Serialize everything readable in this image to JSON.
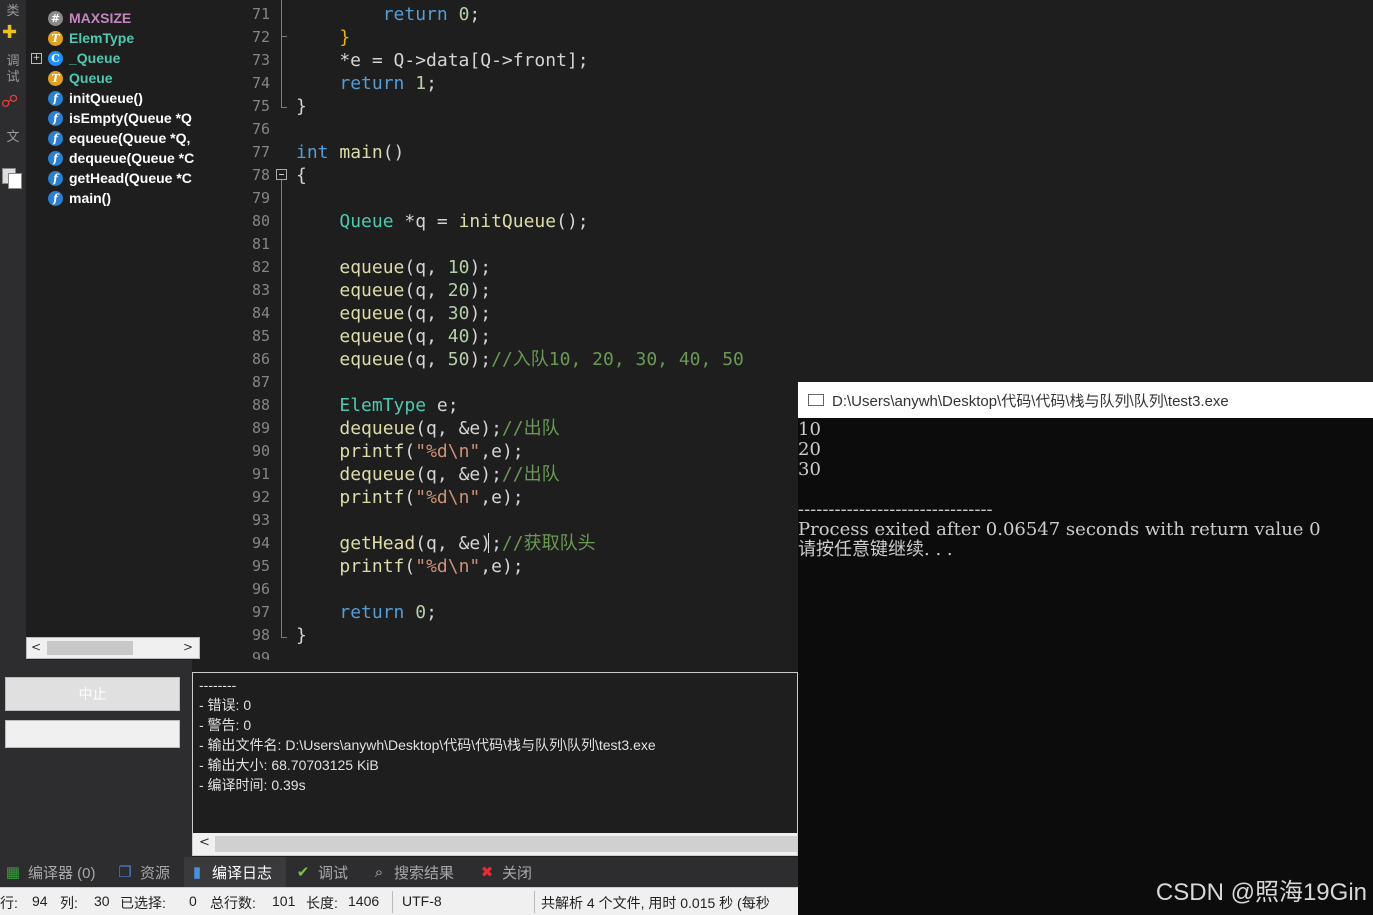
{
  "left_toolbar": {
    "labels": [
      "类",
      "调试",
      "文"
    ]
  },
  "class_browser": {
    "items": [
      {
        "name": "MAXSIZE",
        "kind": "#",
        "color": "#c586c0"
      },
      {
        "name": "ElemType",
        "kind": "T",
        "color": "#4ec9b0"
      },
      {
        "name": "_Queue",
        "kind": "C",
        "color": "#4ec9b0",
        "expandable": "+"
      },
      {
        "name": "Queue",
        "kind": "T",
        "color": "#4ec9b0"
      },
      {
        "name": "initQueue()",
        "kind": "f",
        "color": "#ffffff"
      },
      {
        "name": "isEmpty(Queue *Q",
        "kind": "f",
        "color": "#ffffff"
      },
      {
        "name": "equeue(Queue *Q,",
        "kind": "f",
        "color": "#ffffff"
      },
      {
        "name": "dequeue(Queue *C",
        "kind": "f",
        "color": "#ffffff"
      },
      {
        "name": "getHead(Queue *C",
        "kind": "f",
        "color": "#ffffff"
      },
      {
        "name": "main()",
        "kind": "f",
        "color": "#ffffff"
      }
    ],
    "scroll_left": "<",
    "scroll_right": ">"
  },
  "editor": {
    "line_numbers": [
      "71",
      "72",
      "73",
      "74",
      "75",
      "76",
      "77",
      "78",
      "79",
      "80",
      "81",
      "82",
      "83",
      "84",
      "85",
      "86",
      "87",
      "88",
      "89",
      "90",
      "91",
      "92",
      "93",
      "94",
      "95",
      "96",
      "97",
      "98",
      "99"
    ],
    "current_line": "94",
    "code_lines": [
      [
        {
          "t": "        "
        },
        {
          "t": "return",
          "c": "kw"
        },
        {
          "t": " "
        },
        {
          "t": "0",
          "c": "num"
        },
        {
          "t": ";"
        }
      ],
      [
        {
          "t": "    "
        },
        {
          "t": "}",
          "c": "br"
        }
      ],
      [
        {
          "t": "    *e = Q->data[Q->front];"
        }
      ],
      [
        {
          "t": "    "
        },
        {
          "t": "return",
          "c": "kw"
        },
        {
          "t": " "
        },
        {
          "t": "1",
          "c": "num"
        },
        {
          "t": ";"
        }
      ],
      [
        {
          "t": "}"
        }
      ],
      [
        {
          "t": ""
        }
      ],
      [
        {
          "t": "int",
          "c": "kw"
        },
        {
          "t": " "
        },
        {
          "t": "main",
          "c": "fn"
        },
        {
          "t": "()"
        }
      ],
      [
        {
          "t": "{"
        }
      ],
      [
        {
          "t": ""
        }
      ],
      [
        {
          "t": "    "
        },
        {
          "t": "Queue",
          "c": "ty"
        },
        {
          "t": " *q = "
        },
        {
          "t": "initQueue",
          "c": "fn"
        },
        {
          "t": "();"
        }
      ],
      [
        {
          "t": ""
        }
      ],
      [
        {
          "t": "    "
        },
        {
          "t": "equeue",
          "c": "fn"
        },
        {
          "t": "(q, "
        },
        {
          "t": "10",
          "c": "num"
        },
        {
          "t": ");"
        }
      ],
      [
        {
          "t": "    "
        },
        {
          "t": "equeue",
          "c": "fn"
        },
        {
          "t": "(q, "
        },
        {
          "t": "20",
          "c": "num"
        },
        {
          "t": ");"
        }
      ],
      [
        {
          "t": "    "
        },
        {
          "t": "equeue",
          "c": "fn"
        },
        {
          "t": "(q, "
        },
        {
          "t": "30",
          "c": "num"
        },
        {
          "t": ");"
        }
      ],
      [
        {
          "t": "    "
        },
        {
          "t": "equeue",
          "c": "fn"
        },
        {
          "t": "(q, "
        },
        {
          "t": "40",
          "c": "num"
        },
        {
          "t": ");"
        }
      ],
      [
        {
          "t": "    "
        },
        {
          "t": "equeue",
          "c": "fn"
        },
        {
          "t": "(q, "
        },
        {
          "t": "50",
          "c": "num"
        },
        {
          "t": ");"
        },
        {
          "t": "//入队10, 20, 30, 40, 50",
          "c": "cm"
        }
      ],
      [
        {
          "t": ""
        }
      ],
      [
        {
          "t": "    "
        },
        {
          "t": "ElemType",
          "c": "ty"
        },
        {
          "t": " e;"
        }
      ],
      [
        {
          "t": "    "
        },
        {
          "t": "dequeue",
          "c": "fn"
        },
        {
          "t": "(q, &e);"
        },
        {
          "t": "//出队",
          "c": "cm"
        }
      ],
      [
        {
          "t": "    "
        },
        {
          "t": "printf",
          "c": "fn"
        },
        {
          "t": "("
        },
        {
          "t": "\"%d\\n\"",
          "c": "str"
        },
        {
          "t": ",e);"
        }
      ],
      [
        {
          "t": "    "
        },
        {
          "t": "dequeue",
          "c": "fn"
        },
        {
          "t": "(q, &e);"
        },
        {
          "t": "//出队",
          "c": "cm"
        }
      ],
      [
        {
          "t": "    "
        },
        {
          "t": "printf",
          "c": "fn"
        },
        {
          "t": "("
        },
        {
          "t": "\"%d\\n\"",
          "c": "str"
        },
        {
          "t": ",e);"
        }
      ],
      [
        {
          "t": ""
        }
      ],
      [
        {
          "t": "    "
        },
        {
          "t": "getHead",
          "c": "fn"
        },
        {
          "t": "(q, &e);"
        },
        {
          "t": "//获取队头",
          "c": "cm"
        }
      ],
      [
        {
          "t": "    "
        },
        {
          "t": "printf",
          "c": "fn"
        },
        {
          "t": "("
        },
        {
          "t": "\"%d\\n\"",
          "c": "str"
        },
        {
          "t": ",e);"
        }
      ],
      [
        {
          "t": ""
        }
      ],
      [
        {
          "t": "    "
        },
        {
          "t": "return",
          "c": "kw"
        },
        {
          "t": " "
        },
        {
          "t": "0",
          "c": "num"
        },
        {
          "t": ";"
        }
      ],
      [
        {
          "t": "}"
        }
      ],
      [
        {
          "t": ""
        }
      ]
    ]
  },
  "console": {
    "title": "D:\\Users\\anywh\\Desktop\\代码\\代码\\栈与队列\\队列\\test3.exe",
    "lines": [
      "10",
      "20",
      "30",
      "",
      "--------------------------------",
      "Process exited after 0.06547 seconds with return value 0",
      "请按任意键继续. . ."
    ]
  },
  "controls": {
    "stop_button": "中止"
  },
  "compile_log": {
    "lines": [
      "--------",
      "- 错误: 0",
      "- 警告: 0",
      "- 输出文件名: D:\\Users\\anywh\\Desktop\\代码\\代码\\栈与队列\\队列\\test3.exe",
      "- 输出大小: 68.70703125 KiB",
      "- 编译时间: 0.39s"
    ],
    "scroll_left": "<"
  },
  "bottom_tabs": [
    {
      "label": "编译器 (0)",
      "icon": "compiler-grid-icon",
      "glyph": "▦",
      "active": false
    },
    {
      "label": "资源",
      "icon": "resources-icon",
      "glyph": "❐",
      "active": false
    },
    {
      "label": "编译日志",
      "icon": "compile-log-chart-icon",
      "glyph": "▮",
      "active": true
    },
    {
      "label": "调试",
      "icon": "debug-check-icon",
      "glyph": "✔",
      "active": false
    },
    {
      "label": "搜索结果",
      "icon": "search-results-icon",
      "glyph": "⌕",
      "active": false
    },
    {
      "label": "关闭",
      "icon": "close-x-icon",
      "glyph": "✖",
      "active": false
    }
  ],
  "status_bar": {
    "row_label": "行:",
    "row": "94",
    "col_label": "列:",
    "col": "30",
    "sel_label": "已选择:",
    "sel": "0",
    "lines_label": "总行数:",
    "lines": "101",
    "len_label": "长度:",
    "len": "1406",
    "encoding": "UTF-8",
    "message": "共解析 4 个文件, 用时 0.015 秒 (每秒"
  },
  "watermark": "CSDN @照海19Gin",
  "colors": {
    "keyword": "#569cd6",
    "type": "#4ec9b0",
    "function": "#dcdcaa",
    "number": "#b5cea8",
    "string": "#ce9178",
    "comment": "#6a9955"
  }
}
